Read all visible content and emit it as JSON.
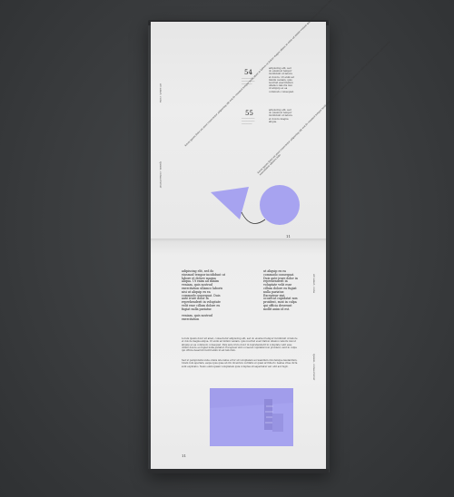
{
  "top_page": {
    "number_54": "54",
    "number_55": "55",
    "page_number": "11",
    "side_label": "sit amet, cons",
    "side_label_2": "ipsum, consectetur"
  },
  "bottom_page": {
    "page_number": "11",
    "side_label": "sit amet, cons",
    "side_label_2": "ipsum, consectetur"
  },
  "colors": {
    "accent": "#a7a3f0",
    "photo": "#a19deb",
    "background": "#3b3d3f",
    "paper": "#ececec"
  },
  "shapes": [
    "lavender-triangle",
    "lavender-circle",
    "dark-arc-line"
  ]
}
